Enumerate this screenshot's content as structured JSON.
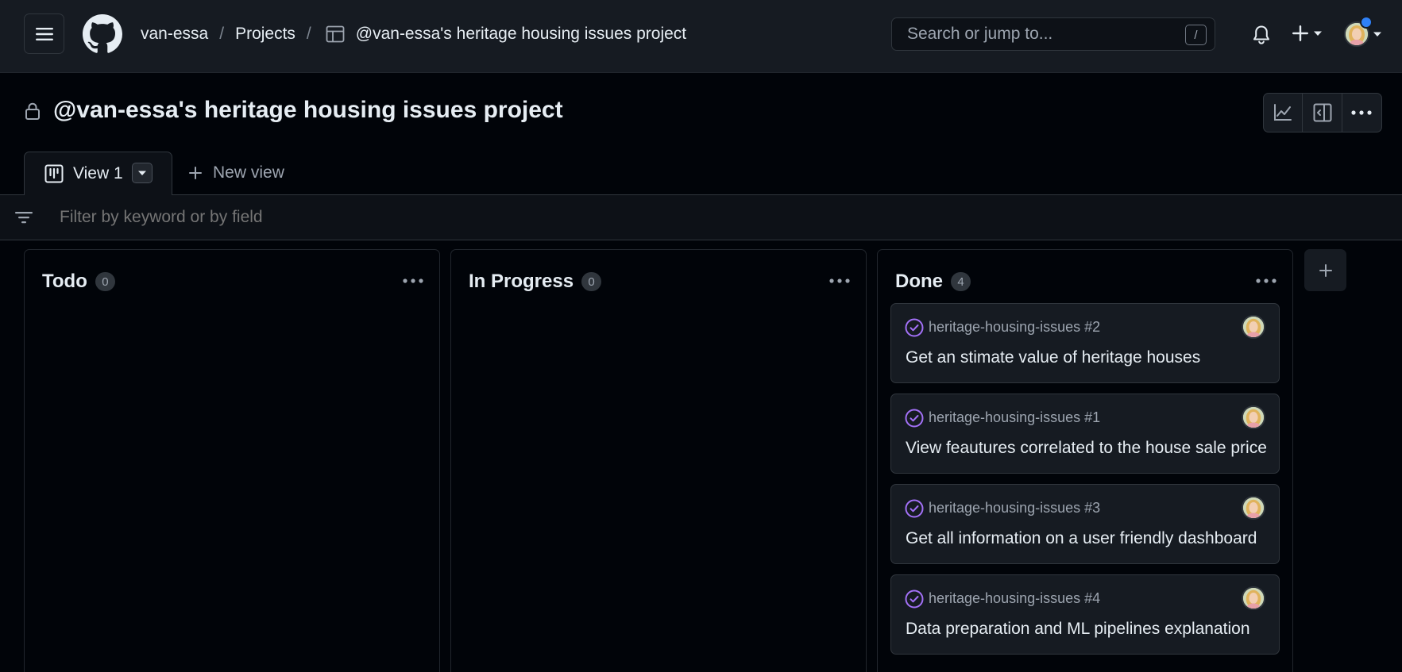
{
  "header": {
    "breadcrumbs": {
      "owner": "van-essa",
      "projects": "Projects",
      "project": "@van-essa's heritage housing issues project"
    },
    "search": {
      "placeholder": "Search or jump to...",
      "shortcut": "/"
    },
    "notification_dot_color": "#2f81f7"
  },
  "project": {
    "title": "@van-essa's heritage housing issues project",
    "visibility_icon": "lock-icon"
  },
  "tabs": {
    "active": "View 1",
    "new_view": "New view"
  },
  "filter": {
    "placeholder": "Filter by keyword or by field"
  },
  "board": {
    "columns": [
      {
        "name": "Todo",
        "count": "0",
        "cards": []
      },
      {
        "name": "In Progress",
        "count": "0",
        "cards": []
      },
      {
        "name": "Done",
        "count": "4",
        "cards": [
          {
            "ref": "heritage-housing-issues #2",
            "title": "Get an stimate value of heritage houses",
            "status": "closed",
            "status_color": "#a371f7"
          },
          {
            "ref": "heritage-housing-issues #1",
            "title": "View feautures correlated to the house sale price",
            "status": "closed",
            "status_color": "#a371f7"
          },
          {
            "ref": "heritage-housing-issues #3",
            "title": "Get all information on a user friendly dashboard",
            "status": "closed",
            "status_color": "#a371f7"
          },
          {
            "ref": "heritage-housing-issues #4",
            "title": "Data preparation and ML pipelines explanation",
            "status": "closed",
            "status_color": "#a371f7"
          }
        ]
      }
    ]
  }
}
